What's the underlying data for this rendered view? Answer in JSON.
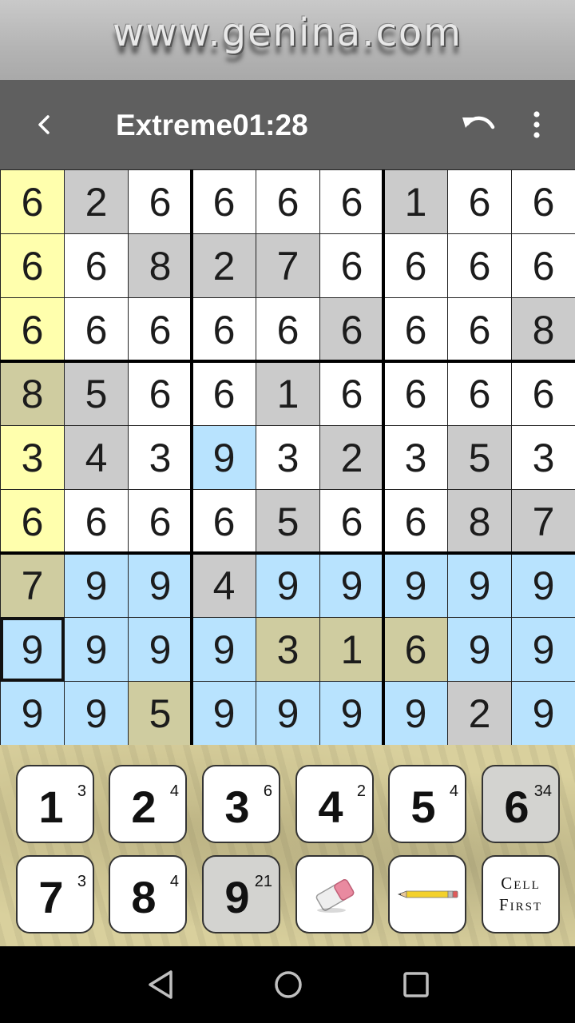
{
  "banner": {
    "text": "www.genina.com"
  },
  "header": {
    "difficulty": "Extreme",
    "timer": "01:28"
  },
  "colors": {
    "white": "#ffffff",
    "gray": "#cbcbcb",
    "yellow": "#ffffad",
    "olive": "#cfcca0",
    "blue": "#b8e3fe"
  },
  "board": {
    "values": [
      [
        "6",
        "2",
        "6",
        "6",
        "6",
        "6",
        "1",
        "6",
        "6"
      ],
      [
        "6",
        "6",
        "8",
        "2",
        "7",
        "6",
        "6",
        "6",
        "6"
      ],
      [
        "6",
        "6",
        "6",
        "6",
        "6",
        "6",
        "6",
        "6",
        "8"
      ],
      [
        "8",
        "5",
        "6",
        "6",
        "1",
        "6",
        "6",
        "6",
        "6"
      ],
      [
        "3",
        "4",
        "3",
        "9",
        "3",
        "2",
        "3",
        "5",
        "3"
      ],
      [
        "6",
        "6",
        "6",
        "6",
        "5",
        "6",
        "6",
        "8",
        "7"
      ],
      [
        "7",
        "9",
        "9",
        "4",
        "9",
        "9",
        "9",
        "9",
        "9"
      ],
      [
        "9",
        "9",
        "9",
        "9",
        "3",
        "1",
        "6",
        "9",
        "9"
      ],
      [
        "9",
        "9",
        "5",
        "9",
        "9",
        "9",
        "9",
        "2",
        "9"
      ]
    ],
    "shading": [
      [
        "yellow",
        "gray",
        "white",
        "white",
        "white",
        "white",
        "gray",
        "white",
        "white"
      ],
      [
        "yellow",
        "white",
        "gray",
        "gray",
        "gray",
        "white",
        "white",
        "white",
        "white"
      ],
      [
        "yellow",
        "white",
        "white",
        "white",
        "white",
        "gray",
        "white",
        "white",
        "gray"
      ],
      [
        "olive",
        "gray",
        "white",
        "white",
        "gray",
        "white",
        "white",
        "white",
        "white"
      ],
      [
        "yellow",
        "gray",
        "white",
        "blue",
        "white",
        "gray",
        "white",
        "gray",
        "white"
      ],
      [
        "yellow",
        "white",
        "white",
        "white",
        "gray",
        "white",
        "white",
        "gray",
        "gray"
      ],
      [
        "olive",
        "blue",
        "blue",
        "gray",
        "blue",
        "blue",
        "blue",
        "blue",
        "blue"
      ],
      [
        "blue",
        "blue",
        "blue",
        "blue",
        "olive",
        "olive",
        "olive",
        "blue",
        "blue"
      ],
      [
        "blue",
        "blue",
        "olive",
        "blue",
        "blue",
        "blue",
        "blue",
        "gray",
        "blue"
      ]
    ],
    "selected": {
      "row": 7,
      "col": 0
    }
  },
  "keypad": {
    "digits": [
      {
        "digit": "1",
        "count": "3",
        "done": false
      },
      {
        "digit": "2",
        "count": "4",
        "done": false
      },
      {
        "digit": "3",
        "count": "6",
        "done": false
      },
      {
        "digit": "4",
        "count": "2",
        "done": false
      },
      {
        "digit": "5",
        "count": "4",
        "done": false
      },
      {
        "digit": "6",
        "count": "34",
        "done": true
      },
      {
        "digit": "7",
        "count": "3",
        "done": false
      },
      {
        "digit": "8",
        "count": "4",
        "done": false
      },
      {
        "digit": "9",
        "count": "21",
        "done": true
      }
    ],
    "cell_first_line1": "Cell",
    "cell_first_line2": "First"
  },
  "icons": {
    "back": "chevron-left-icon",
    "undo": "undo-icon",
    "menu": "more-vertical-icon",
    "eraser": "eraser-icon",
    "pencil": "pencil-icon",
    "nav_back": "triangle-back-icon",
    "nav_home": "circle-home-icon",
    "nav_recents": "square-recents-icon"
  }
}
